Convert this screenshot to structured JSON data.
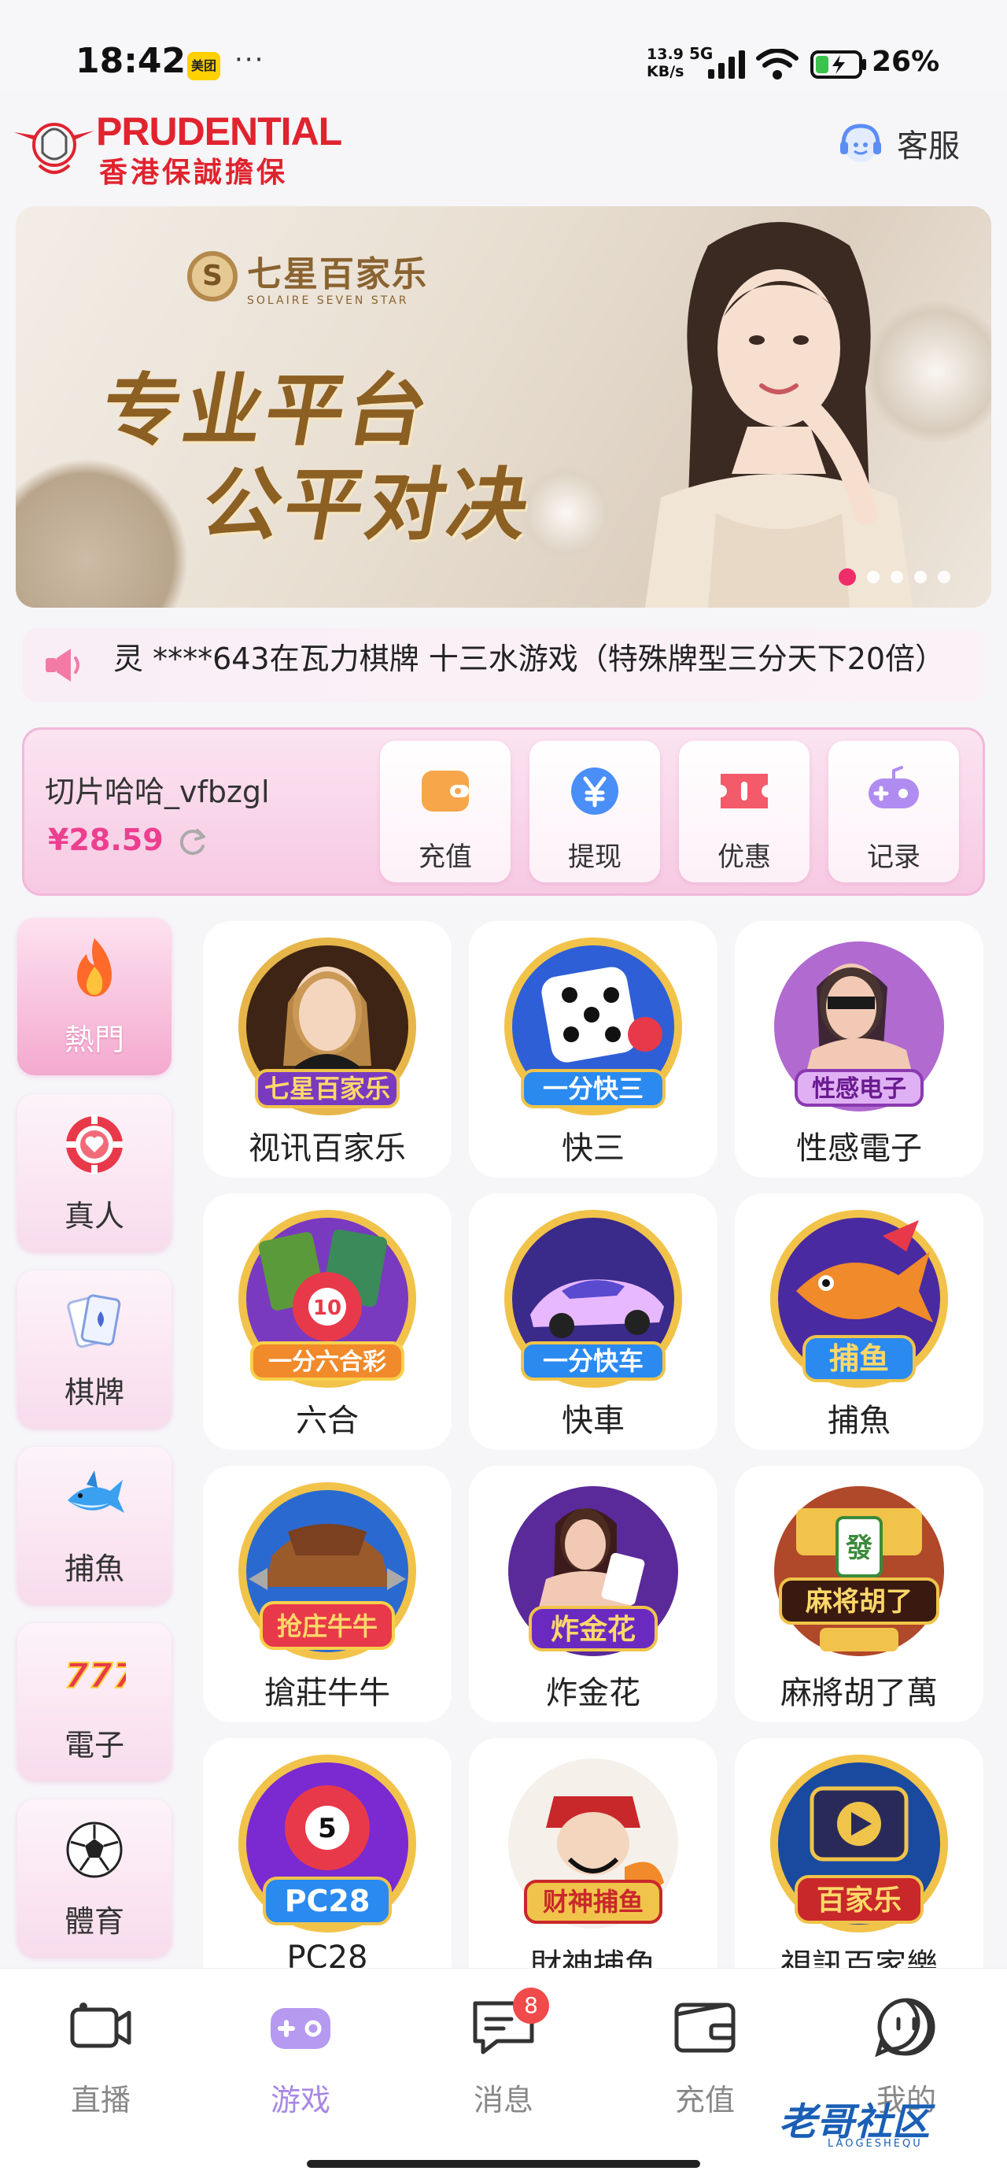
{
  "status": {
    "time": "18:42",
    "app_badge": "美团",
    "dots": "···",
    "speed": "13.9\nKB/s",
    "network": "5G",
    "battery": "26%"
  },
  "header": {
    "logo_en": "PRUDENTIAL",
    "logo_cn": "香港保誠擔保",
    "service_label": "客服"
  },
  "banner": {
    "brand_name": "七星百家乐",
    "brand_sub": "SOLAIRE SEVEN STAR",
    "slogan_line1": "专业平台",
    "slogan_line2": "公平对决",
    "active_index": 0,
    "slides": 5
  },
  "marquee": {
    "text": "灵 ****643在瓦力棋牌 十三水游戏（特殊牌型三分天下20倍）"
  },
  "wallet": {
    "username": "切片哈哈_vfbzgl",
    "balance": "¥28.59",
    "actions": [
      {
        "label": "充值",
        "icon": "wallet-icon",
        "color": "#f7a64a"
      },
      {
        "label": "提现",
        "icon": "yen-coin-icon",
        "color": "#4a8ef7"
      },
      {
        "label": "优惠",
        "icon": "ticket-icon",
        "color": "#f35a6a"
      },
      {
        "label": "记录",
        "icon": "gamepad-icon",
        "color": "#b08cf0"
      }
    ]
  },
  "categories": [
    {
      "label": "熱門",
      "icon": "flame-icon",
      "active": true
    },
    {
      "label": "真人",
      "icon": "poker-chip-icon",
      "active": false
    },
    {
      "label": "棋牌",
      "icon": "playing-cards-icon",
      "active": false
    },
    {
      "label": "捕魚",
      "icon": "shark-icon",
      "active": false
    },
    {
      "label": "電子",
      "icon": "slot-777-icon",
      "active": false
    },
    {
      "label": "體育",
      "icon": "soccer-ball-icon",
      "active": false
    }
  ],
  "games": [
    {
      "label": "视讯百家乐",
      "badge": "七星百家乐",
      "icon": "baccarat-game-icon"
    },
    {
      "label": "快三",
      "badge": "一分快三",
      "icon": "dice-game-icon"
    },
    {
      "label": "性感電子",
      "badge": "性感电子",
      "icon": "sexy-slot-game-icon"
    },
    {
      "label": "六合",
      "badge": "一分六合彩",
      "icon": "lottery-ball-game-icon"
    },
    {
      "label": "快車",
      "badge": "一分快车",
      "icon": "race-car-game-icon"
    },
    {
      "label": "捕魚",
      "badge": "捕鱼",
      "icon": "fishing-game-icon"
    },
    {
      "label": "搶莊牛牛",
      "badge": "抢庄牛牛",
      "icon": "bull-game-icon"
    },
    {
      "label": "炸金花",
      "badge": "炸金花",
      "icon": "golden-flower-game-icon"
    },
    {
      "label": "麻將胡了萬",
      "badge": "麻将胡了",
      "icon": "mahjong-game-icon"
    },
    {
      "label": "PC28",
      "badge": "PC28",
      "icon": "pc28-game-icon"
    },
    {
      "label": "財神捕魚",
      "badge": "财神捕鱼",
      "icon": "god-of-wealth-game-icon"
    },
    {
      "label": "視訊百家樂",
      "badge": "百家乐",
      "icon": "live-baccarat-game-icon"
    }
  ],
  "nav": [
    {
      "label": "直播",
      "icon": "camera-icon",
      "active": false
    },
    {
      "label": "游戏",
      "icon": "gamepad-icon",
      "active": true
    },
    {
      "label": "消息",
      "icon": "message-icon",
      "active": false,
      "badge": "8"
    },
    {
      "label": "充值",
      "icon": "wallet-icon",
      "active": false
    },
    {
      "label": "我的",
      "icon": "smiley-icon",
      "active": false
    }
  ],
  "watermark": {
    "text": "老哥社区",
    "sub": "LAOGESHEQU"
  }
}
